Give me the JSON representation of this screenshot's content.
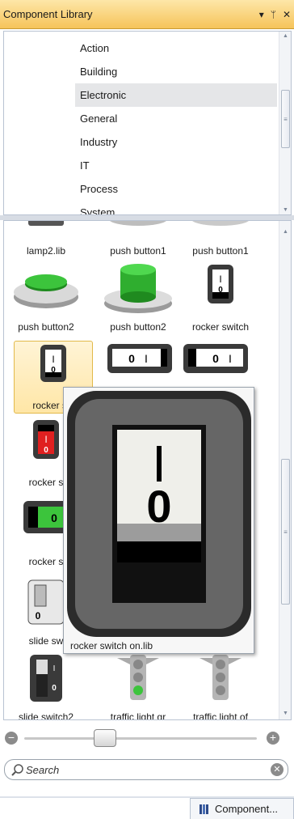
{
  "window": {
    "title": "Component Library",
    "controls": {
      "dropdown": "▾",
      "pin": "ᛘ",
      "close": "✕"
    }
  },
  "categories": {
    "items": [
      "Action",
      "Building",
      "Electronic",
      "General",
      "Industry",
      "IT",
      "Process",
      "System"
    ],
    "selected": "Electronic"
  },
  "components": {
    "tiles": [
      "lamp2.lib",
      "push button1",
      "push button1",
      "push button2",
      "push button2",
      "rocker switch",
      "rocker sw",
      "rocker s",
      "rocker s",
      "slide sw",
      "slide switch2",
      "traffic light gr",
      "traffic light of"
    ],
    "preview_caption": "rocker switch on.lib"
  },
  "search": {
    "placeholder": "Search",
    "value": ""
  },
  "zoom": {
    "level_fraction": 0.33
  },
  "taskbar": {
    "tab_label": "Component..."
  },
  "colors": {
    "titlebar": "#f6c45a",
    "selection": "#ffe6a6",
    "green": "#3cc43c",
    "red": "#e02020"
  }
}
